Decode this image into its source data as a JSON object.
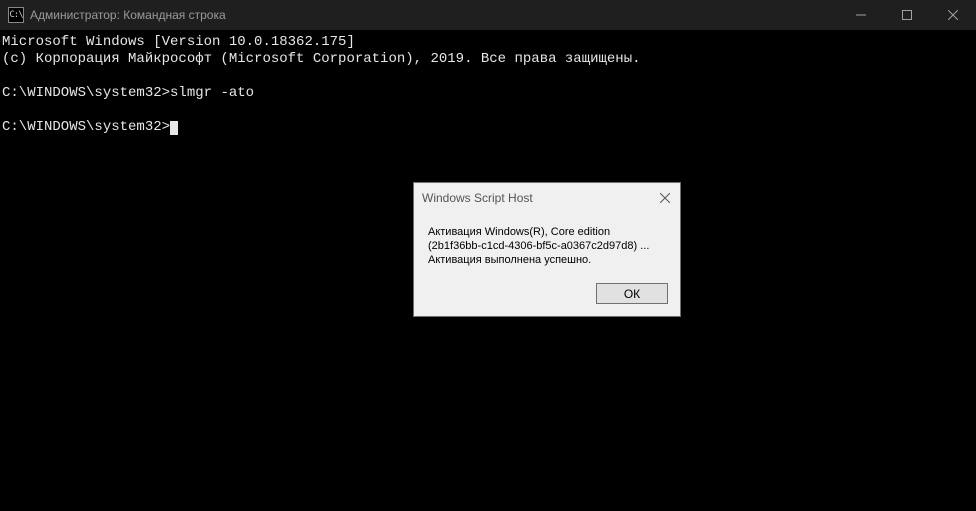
{
  "titlebar": {
    "icon_text": "C:\\",
    "title": "Администратор: Командная строка"
  },
  "terminal": {
    "line1": "Microsoft Windows [Version 10.0.18362.175]",
    "line2": "(c) Корпорация Майкрософт (Microsoft Corporation), 2019. Все права защищены.",
    "blank1": "",
    "prompt1_path": "C:\\WINDOWS\\system32>",
    "prompt1_cmd": "slmgr -ato",
    "blank2": "",
    "prompt2_path": "C:\\WINDOWS\\system32>"
  },
  "dialog": {
    "title": "Windows Script Host",
    "msg_line1": "Активация Windows(R), Core edition",
    "msg_line2": "(2b1f36bb-c1cd-4306-bf5c-a0367c2d97d8) ...",
    "msg_line3": "Активация выполнена успешно.",
    "ok_label": "ОК"
  }
}
